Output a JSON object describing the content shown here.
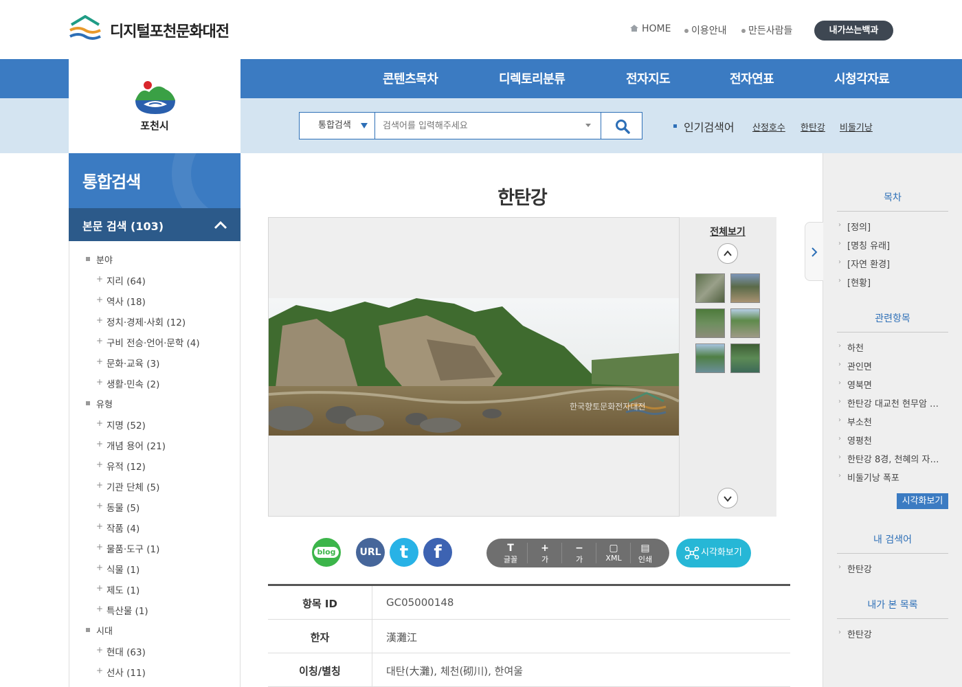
{
  "site": {
    "title": "디지털포천문화대전",
    "util_links": [
      "HOME",
      "이용안내",
      "만든사람들"
    ],
    "my_baekgwa": "내가쓰는백과",
    "city_label": "포천시"
  },
  "nav": [
    "콘텐츠목차",
    "디렉토리분류",
    "전자지도",
    "전자연표",
    "시청각자료"
  ],
  "search": {
    "type_label": "통합검색",
    "placeholder": "검색어를 입력해주세요",
    "popular_label": "인기검색어",
    "popular_terms": [
      "산정호수",
      "한탄강",
      "비둘기낭"
    ]
  },
  "left_sidebar": {
    "title": "통합검색",
    "section_label": "본문 검색 (103)",
    "groups": [
      {
        "label": "분야",
        "items": [
          "지리 (64)",
          "역사 (18)",
          "정치·경제·사회 (12)",
          "구비 전승·언어·문학 (4)",
          "문화·교육 (3)",
          "생활·민속 (2)"
        ]
      },
      {
        "label": "유형",
        "items": [
          "지명 (52)",
          "개념 용어 (21)",
          "유적 (12)",
          "기관 단체 (5)",
          "동물 (5)",
          "작품 (4)",
          "물품·도구 (1)",
          "식물 (1)",
          "제도 (1)",
          "특산물 (1)"
        ]
      },
      {
        "label": "시대",
        "items": [
          "현대 (63)",
          "선사 (11)"
        ]
      }
    ]
  },
  "article": {
    "title": "한탄강",
    "full_view": "전체보기",
    "watermark": "한국향토문화전자대전",
    "share": {
      "blog": "blog",
      "url": "URL"
    },
    "tools": [
      {
        "glyph": "T",
        "label": "글꼴"
      },
      {
        "glyph": "+",
        "label": "가"
      },
      {
        "glyph": "−",
        "label": "가"
      },
      {
        "glyph": "▢",
        "label": "XML"
      },
      {
        "glyph": "▤",
        "label": "인쇄"
      }
    ],
    "viz_button": "시각화보기",
    "info": [
      {
        "key": "항목 ID",
        "value": "GC05000148"
      },
      {
        "key": "한자",
        "value": "漢灘江"
      },
      {
        "key": "이칭/별칭",
        "value": "대탄(大灘), 체천(砌川), 한여울"
      }
    ]
  },
  "right_sidebar": {
    "toc_title": "목차",
    "toc": [
      "[정의]",
      "[명칭 유래]",
      "[자연 환경]",
      "[현황]"
    ],
    "related_title": "관련항목",
    "related": [
      "하천",
      "관인면",
      "영북면",
      "한탄강 대교천 현무암 …",
      "부소천",
      "영평천",
      "한탄강 8경, 천혜의 자…",
      "비둘기낭 폭포"
    ],
    "viz_button": "시각화보기",
    "my_search_title": "내 검색어",
    "my_search": [
      "한탄강"
    ],
    "my_view_title": "내가 본 목록",
    "my_view": [
      "한탄강"
    ]
  },
  "colors": {
    "brand_blue": "#3b7bc2",
    "light_blue": "#d4e4f1",
    "dark_blue": "#2c5a8a",
    "viz_cyan": "#26b7d6"
  }
}
